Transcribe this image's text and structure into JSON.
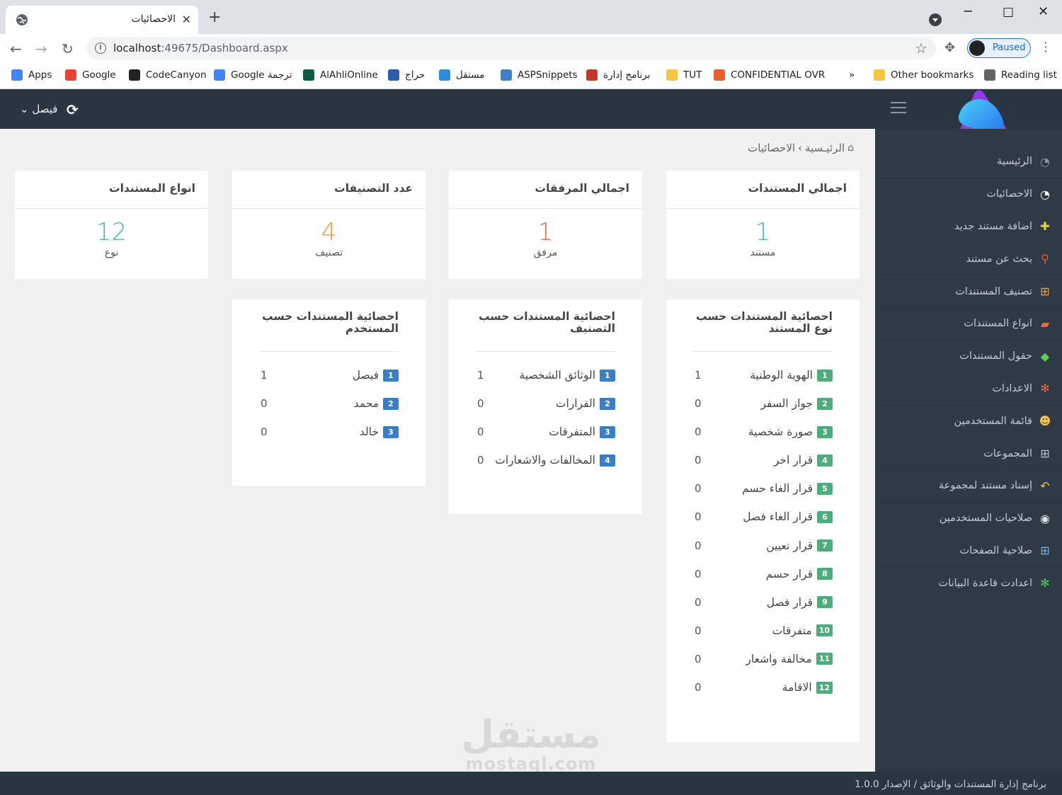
{
  "browser": {
    "tab_title": "الاحصائيات",
    "tab_close": "✕",
    "new_tab": "+",
    "url_host": "localhost",
    "url_rest": ":49675/Dashboard.aspx",
    "profile_status": "Paused",
    "bookmarks": [
      {
        "label": "Apps",
        "icon": "apps-grid-icon",
        "color": "#4285f4"
      },
      {
        "label": "Google",
        "icon": "google-icon",
        "color": "#ea4335"
      },
      {
        "label": "CodeCanyon",
        "icon": "codecanyon-icon",
        "color": "#222222"
      },
      {
        "label": "Google ترجمة",
        "icon": "translate-icon",
        "color": "#4285f4"
      },
      {
        "label": "AlAhliOnline",
        "icon": "alahli-icon",
        "color": "#0e5a45"
      },
      {
        "label": "حراج",
        "icon": "haraj-icon",
        "color": "#2a5ca8"
      },
      {
        "label": "مستقل",
        "icon": "mostaql-icon",
        "color": "#2d8be0"
      },
      {
        "label": "ASPSnippets",
        "icon": "aspsnippets-icon",
        "color": "#3f7fc4"
      },
      {
        "label": "برنامج إدارة",
        "icon": "app-icon",
        "color": "#c0392b"
      },
      {
        "label": "TUT",
        "icon": "folder-icon",
        "color": "#f5c542"
      },
      {
        "label": "CONFIDENTIAL OVR",
        "icon": "confidential-icon",
        "color": "#e8602c"
      },
      {
        "label": "»",
        "icon": "",
        "color": ""
      },
      {
        "label": "Other bookmarks",
        "icon": "folder-icon",
        "color": "#f5c542"
      },
      {
        "label": "Reading list",
        "icon": "reading-list-icon",
        "color": "#5f6368"
      }
    ]
  },
  "header": {
    "user_name": "فيصل",
    "user_caret": "⌄"
  },
  "sidebar": {
    "items": [
      {
        "label": "الرئيسية",
        "icon": "dashboard-icon",
        "glyph": "◔",
        "color": "#8b96a3"
      },
      {
        "label": "الاحصائيات",
        "icon": "dashboard-icon",
        "glyph": "◔",
        "color": "#ffffff"
      },
      {
        "label": "اضافة مستند جديد",
        "icon": "plus-square-icon",
        "glyph": "✚",
        "color": "#e6d23a"
      },
      {
        "label": "بحث عن مستند",
        "icon": "search-icon",
        "glyph": "⚲",
        "color": "#e95a3a"
      },
      {
        "label": "تصنيف المستندات",
        "icon": "sitemap-icon",
        "glyph": "⊞",
        "color": "#f0a34a"
      },
      {
        "label": "انواع المستندات",
        "icon": "folder-open-icon",
        "glyph": "▰",
        "color": "#f06c4c"
      },
      {
        "label": "حقول المستندات",
        "icon": "tags-icon",
        "glyph": "◆",
        "color": "#5fd04c"
      },
      {
        "label": "الاعدادات",
        "icon": "cogs-icon",
        "glyph": "✻",
        "color": "#f0663a"
      },
      {
        "label": "قائمة المستخدمين",
        "icon": "users-icon",
        "glyph": "☻",
        "color": "#f2c14a"
      },
      {
        "label": "المجموعات",
        "icon": "sitemap-icon",
        "glyph": "⊞",
        "color": "#b9c2cc"
      },
      {
        "label": "إسناد مستند لمجموعة",
        "icon": "reply-all-icon",
        "glyph": "↶",
        "color": "#f2c14a"
      },
      {
        "label": "صلاحيات المستخدمين",
        "icon": "user-circle-icon",
        "glyph": "◉",
        "color": "#dde2e7"
      },
      {
        "label": "صلاحية الصفحات",
        "icon": "sitemap-icon",
        "glyph": "⊞",
        "color": "#7fb3e6"
      },
      {
        "label": "اعدادت قاعدة البيانات",
        "icon": "cogs-icon",
        "glyph": "✻",
        "color": "#4fd06a"
      }
    ]
  },
  "breadcrumb": {
    "home": "الرئيـسية",
    "separator": "›",
    "current": "الاحصائيات"
  },
  "stats": [
    {
      "title": "اجمالي المستندات",
      "value": "1",
      "unit": "مستند",
      "color": "#4fb3c9"
    },
    {
      "title": "اجمالي المرفقات",
      "value": "1",
      "unit": "مرفق",
      "color": "#e86a4a"
    },
    {
      "title": "عدد التصنيفات",
      "value": "4",
      "unit": "تصنيف",
      "color": "#f0a04a"
    },
    {
      "title": "انواع المستندات",
      "value": "12",
      "unit": "نوع",
      "color": "#4fb3c9"
    }
  ],
  "lists": [
    {
      "title": "احصائية المستندات حسب نوع المستند",
      "badge_color": "#4cae7d",
      "items": [
        {
          "num": "1",
          "label": "الهوية الوطنية",
          "count": "1"
        },
        {
          "num": "2",
          "label": "جواز السفر",
          "count": "0"
        },
        {
          "num": "3",
          "label": "صورة شخصية",
          "count": "0"
        },
        {
          "num": "4",
          "label": "قرار اخر",
          "count": "0"
        },
        {
          "num": "5",
          "label": "قرار الغاء حسم",
          "count": "0"
        },
        {
          "num": "6",
          "label": "قرار الغاء فصل",
          "count": "0"
        },
        {
          "num": "7",
          "label": "قرار تعيين",
          "count": "0"
        },
        {
          "num": "8",
          "label": "قرار حسم",
          "count": "0"
        },
        {
          "num": "9",
          "label": "قرار فصل",
          "count": "0"
        },
        {
          "num": "10",
          "label": "متفرقات",
          "count": "0"
        },
        {
          "num": "11",
          "label": "مخالفة واشعار",
          "count": "0"
        },
        {
          "num": "12",
          "label": "الاقامة",
          "count": "0"
        }
      ]
    },
    {
      "title": "احصائية المستندات حسب التصنيف",
      "badge_color": "#3a7fc4",
      "items": [
        {
          "num": "1",
          "label": "الوثائق الشخصية",
          "count": "1"
        },
        {
          "num": "2",
          "label": "القرارات",
          "count": "0"
        },
        {
          "num": "3",
          "label": "المتفرقات",
          "count": "0"
        },
        {
          "num": "4",
          "label": "المخالفات والاشعارات",
          "count": "0"
        }
      ]
    },
    {
      "title": "احصائية المستندات حسب المستخدم",
      "badge_color": "#3a7fc4",
      "items": [
        {
          "num": "1",
          "label": "فيصل",
          "count": "1"
        },
        {
          "num": "2",
          "label": "محمد",
          "count": "0"
        },
        {
          "num": "3",
          "label": "خالد",
          "count": "0"
        }
      ]
    }
  ],
  "footer": {
    "text": "برنامج إدارة المستندات والوثائق / الإصدار 1.0.0"
  },
  "watermark": {
    "arabic": "مستقل",
    "latin": "mostaql.com"
  }
}
